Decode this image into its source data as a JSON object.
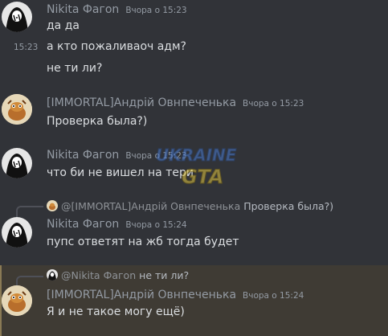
{
  "messages": [
    {
      "author": "Nikita Фагоn",
      "timestamp": "Вчора о 15:23",
      "lines": [
        {
          "text": "да да"
        },
        {
          "text": "а кто пожаливаоч адм?",
          "side_ts": "15:23"
        },
        {
          "text": "не ти ли?"
        }
      ]
    },
    {
      "author": "[IMMORTAL]Андрій Овнпеченька",
      "timestamp": "Вчора о 15:23",
      "lines": [
        {
          "text": "Проверка была?)"
        }
      ]
    },
    {
      "author": "Nikita Фагоn",
      "timestamp": "Вчора о 15:23",
      "lines": [
        {
          "text": "что би не вишел на тери"
        }
      ]
    },
    {
      "reply": {
        "author": "@[IMMORTAL]Андрій Овнпеченька",
        "text": "Проверка была?)"
      },
      "author": "Nikita Фагоn",
      "timestamp": "Вчора о 15:24",
      "lines": [
        {
          "text": "пупс ответят на жб тогда будет"
        }
      ]
    },
    {
      "reply": {
        "author": "@Nikita Фагоn",
        "text": "не ти ли?"
      },
      "author": "[IMMORTAL]Андрій Овнпеченька",
      "timestamp": "Вчора о 15:24",
      "lines": [
        {
          "text": "Я и не такое могу ещё)"
        }
      ]
    }
  ],
  "watermark": {
    "line1": "UKRAINE",
    "line2": "GTA"
  },
  "colors": {
    "background": "#313338",
    "highlight": "#3f3b34",
    "text": "#dbdee1",
    "muted": "#949ba4"
  }
}
